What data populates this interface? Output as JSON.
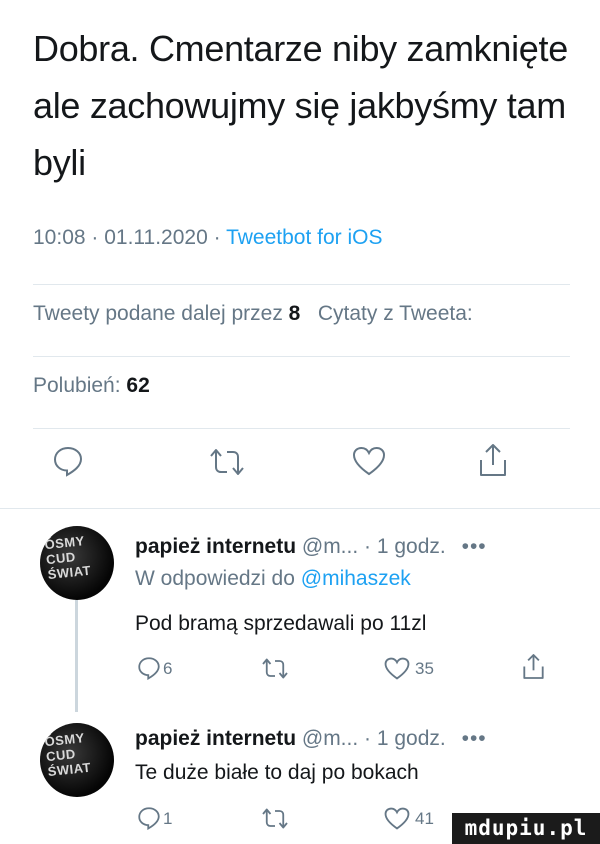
{
  "tweet": {
    "text": "Dobra. Cmentarze niby zamknięte ale zachowujmy się jakbyśmy tam byli",
    "time": "10:08",
    "date": "01.11.2020",
    "client": "Tweetbot for iOS",
    "retweets_label": "Tweety podane dalej przez",
    "retweets_count": "8",
    "quotes_label": "Cytaty z Tweeta:",
    "likes_label": "Polubień:",
    "likes_count": "62"
  },
  "actions": {
    "reply_icon": "reply-icon",
    "retweet_icon": "retweet-icon",
    "like_icon": "heart-icon",
    "share_icon": "share-icon"
  },
  "replies": [
    {
      "avatar_text": "ÓSMY CUD ŚWIAT",
      "name": "papież internetu",
      "handle": "@m... · 1 godz.",
      "more": "•••",
      "reply_prefix": "W odpowiedzi do",
      "reply_mention": "@mihaszek",
      "text": "Pod bramą sprzedawali po 11zl",
      "reply_count": "6",
      "like_count": "35"
    },
    {
      "avatar_text": "ÓSMY CUD ŚWIAT",
      "name": "papież internetu",
      "handle": "@m... · 1 godz.",
      "more": "•••",
      "text": "Te duże białe to daj po bokach",
      "reply_count": "1",
      "like_count": "41"
    }
  ],
  "watermark": {
    "text": "mdupiu.pl"
  },
  "colors": {
    "accent": "#1da1f2",
    "muted": "#657786",
    "text": "#14171a",
    "rule": "#e1e8ed"
  }
}
